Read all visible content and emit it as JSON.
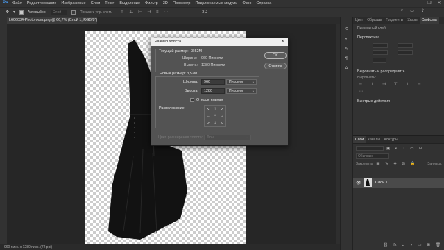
{
  "menubar": {
    "items": [
      "Файл",
      "Редактирование",
      "Изображение",
      "Слои",
      "Текст",
      "Выделение",
      "Фильтр",
      "3D",
      "Просмотр",
      "Подключаемые модули",
      "Окно",
      "Справка"
    ],
    "window_buttons": [
      "—",
      "❐",
      "✕"
    ]
  },
  "options": {
    "autoselect_label": "Автовыбор:",
    "autoselect_value": "Слой",
    "show_transform_label": "Показать упр. элем."
  },
  "document": {
    "tab_title": "L606034-Photoroom.png @ 66,7% (Слой 1, RGB/8*)"
  },
  "status": {
    "text": "960 пикс. x 1280 пикс. (72 ppi)"
  },
  "right_panel": {
    "tabs": [
      "Цвет",
      "Образцы",
      "Градиенты",
      "Узоры",
      "Свойства"
    ],
    "properties_heading": "Пиксельный слой",
    "perspective_label": "Перспектива",
    "align_label": "Выровнять и распределить",
    "align_sub": "Выровнять:",
    "quick_actions_label": "Быстрые действия",
    "layers_tabs": [
      "Слои",
      "Каналы",
      "Контуры"
    ],
    "blend_mode": "Обычные",
    "lock_label": "Закрепить:",
    "fill_label": "Заливка:",
    "layer_name": "Слой 1"
  },
  "dialog": {
    "title": "Размер холста",
    "current_size_label": "Текущий размер:",
    "current_size_value": "3,52M",
    "width_label": "Ширина:",
    "current_width": "960 Пиксели",
    "height_label": "Высота:",
    "current_height": "1280 Пиксели",
    "new_size_label": "Новый размер: 3,52M",
    "new_width_value": "960",
    "new_height_value": "1280",
    "unit_option": "Пиксели",
    "relative_label": "Относительная",
    "anchor_label": "Расположение:",
    "anchor_arrows": [
      "↖",
      "↑",
      "↗",
      "←",
      "•",
      "→",
      "↙",
      "↓",
      "↘"
    ],
    "extension_label": "Цвет расширения холста:",
    "extension_value": "Фон",
    "ok_label": "OK",
    "cancel_label": "Отмена"
  },
  "colors": {
    "accent": "#4aa3ff",
    "panel_bg": "#323232",
    "dialog_bg": "#535353",
    "canvas_bg": "#262626"
  }
}
